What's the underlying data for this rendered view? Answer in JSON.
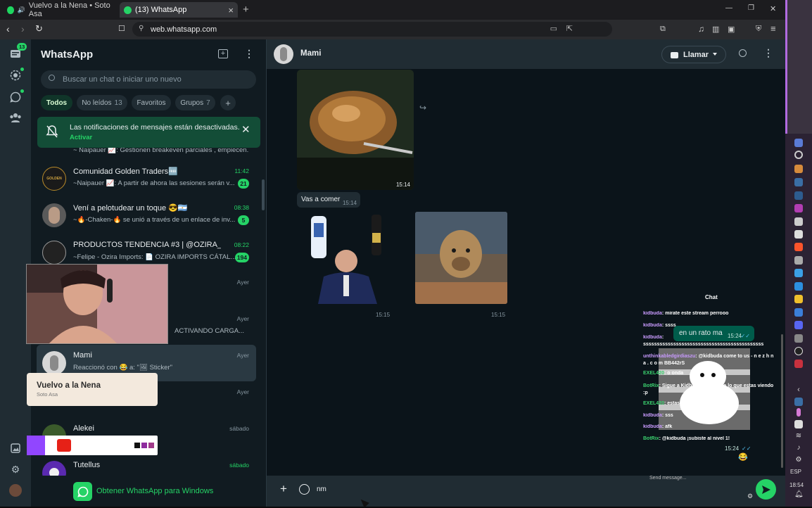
{
  "browser": {
    "tabs": [
      {
        "title": "Vuelvo a la Nena • Soto Asa",
        "close": ""
      },
      {
        "title": "(13) WhatsApp",
        "close": "×"
      }
    ],
    "new_tab": "+",
    "url": "web.whatsapp.com",
    "window_controls": {
      "minimize": "—",
      "maximize": "❐",
      "close": "✕"
    }
  },
  "rail": {
    "chats_badge": "13"
  },
  "sidebar": {
    "title": "WhatsApp",
    "search_placeholder": "Buscar un chat o iniciar uno nuevo",
    "filters": [
      {
        "label": "Todos",
        "count": ""
      },
      {
        "label": "No leídos",
        "count": "13"
      },
      {
        "label": "Favoritos",
        "count": ""
      },
      {
        "label": "Grupos",
        "count": "7"
      }
    ],
    "add_filter": "+",
    "notification": {
      "text": "Las notificaciones de mensajes están desactivadas.",
      "action": "Activar"
    },
    "partial_preview": "~ Naipauer 📈: Gestionen breakeven parciales , empiecen...",
    "chats": [
      {
        "name": "Comunidad Golden Traders🆓",
        "preview": "~Naipauer 📈: A partir de ahora las sesiones serán v...",
        "time": "11:42",
        "unread": "21",
        "avatar_color": "#1a1a1a"
      },
      {
        "name": "Vení a pelotudear un toque 😎🇦🇷",
        "preview": "~🔥-Chaken-🔥 se unió a través de un enlace de inv...",
        "time": "08:38",
        "unread": "5",
        "avatar_color": "#5a5a5a"
      },
      {
        "name": "PRODUCTOS TENDENCIA #3 | @OZIRA_IMP...",
        "preview": "~Felipe - Ozira Imports: 📄 OZIRA IMPORTS CÁTAL...",
        "time": "08:22",
        "unread": "194",
        "avatar_color": "#222"
      },
      {
        "name": "",
        "preview": "",
        "time": "Ayer",
        "unread": "",
        "avatar_color": "#333"
      },
      {
        "name": "",
        "preview": "ACTIVANDO CARGA...",
        "time": "Ayer",
        "unread": "",
        "avatar_color": "#333"
      },
      {
        "name": "Mami",
        "preview": "Reaccionó con 😂 a: \"🖼 Sticker\"",
        "time": "Ayer",
        "unread": "",
        "avatar_color": "#d7d7d7"
      },
      {
        "name": "",
        "preview": "",
        "time": "Ayer",
        "unread": "",
        "avatar_color": "#7a4030"
      },
      {
        "name": "Alekei",
        "preview": "",
        "time": "sábado",
        "unread": "",
        "avatar_color": "#3b5b2b"
      },
      {
        "name": "Tutellus",
        "preview": "",
        "time": "sábado",
        "unread": "",
        "avatar_color": "#5a2ab0"
      }
    ],
    "download_cta": "Obtener WhatsApp para Windows"
  },
  "conversation": {
    "contact": "Mami",
    "call_label": "Llamar",
    "messages": [
      {
        "type": "image",
        "caption": "",
        "time": "15:14"
      },
      {
        "type": "text",
        "text": "Vas a comer",
        "time": "15:14"
      },
      {
        "type": "sticker",
        "time": "15:15"
      },
      {
        "type": "sticker",
        "time": "15:15"
      }
    ],
    "outgoing_text": "en un rato ma",
    "outgoing_time": "15:24",
    "outgoing_sticker_time": "15:24",
    "reaction": "😂",
    "composer_value": "nm"
  },
  "overlay": {
    "now_playing_title": "Vuelvo a la Nena",
    "now_playing_artist": "Soto Asa",
    "stream_chat_title": "Chat",
    "stream_chat": [
      {
        "user": "kidbuda",
        "msg": "mirate este stream perrooo"
      },
      {
        "user": "kidbuda",
        "msg": "ssss"
      },
      {
        "user": "kidbuda",
        "msg": ""
      },
      {
        "user": "",
        "msg": "ssssssssssssssssssssssssssssssssssssssssssss"
      },
      {
        "user": "unthinkabledgirdiaszu",
        "msg": "@kidbuda come to us - n e z h n a . c o m BB442rS"
      },
      {
        "user": "EXEL420",
        "msg": "o onda"
      },
      {
        "user": "BotRix",
        "msg": "Sigue a Kidbuda si te gusta lo que estas viendo :p"
      },
      {
        "user": "EXEL420",
        "msg": "estas aca"
      },
      {
        "user": "kidbuda",
        "msg": "sss"
      },
      {
        "user": "kidbuda",
        "msg": "afk"
      },
      {
        "user": "BotRix",
        "msg": "@kidbuda ¡subiste al nivel 1!"
      }
    ],
    "send_placeholder": "Send message..."
  },
  "taskbar": {
    "lang": "ESP",
    "clock": "18:54"
  },
  "colors": {
    "accent": "#25d366",
    "panel": "#111b21",
    "header": "#202c33",
    "chat_bg": "#0b141a",
    "notif": "#134d37"
  }
}
